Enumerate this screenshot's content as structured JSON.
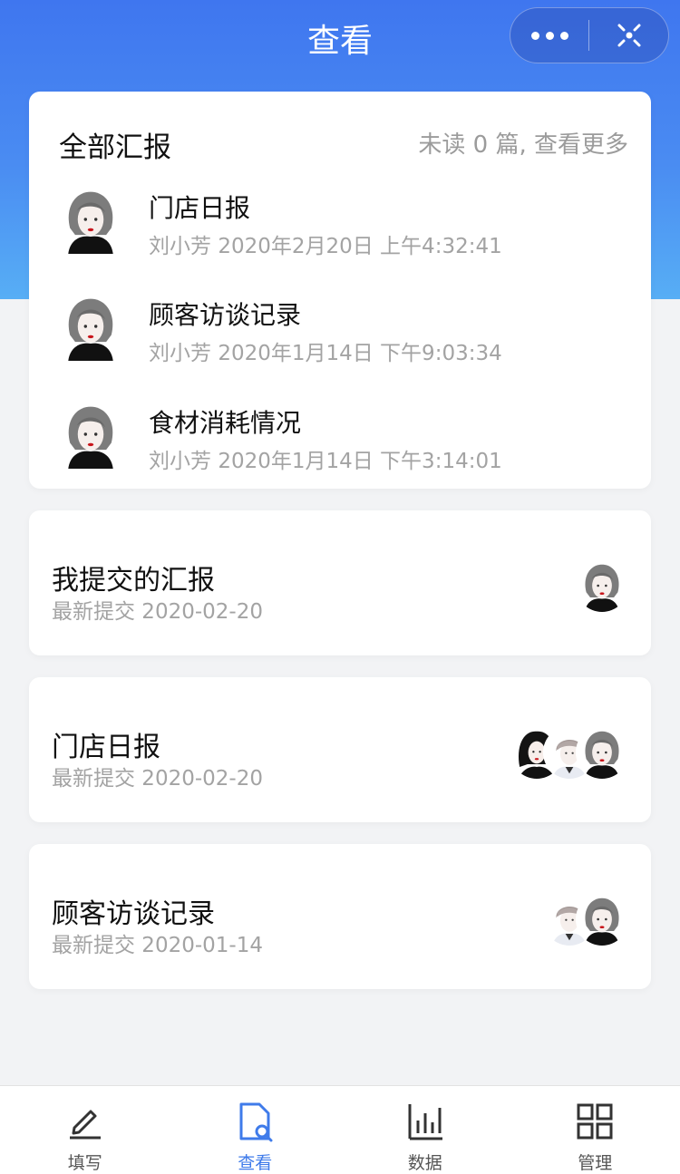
{
  "header": {
    "title": "查看"
  },
  "capsule": {
    "more_icon": "more-dots-icon",
    "close_icon": "close-target-icon"
  },
  "all_reports": {
    "title": "全部汇报",
    "unread_link": "未读 0 篇, 查看更多",
    "items": [
      {
        "title": "门店日报",
        "author": "刘小芳",
        "time": "2020年2月20日 上午4:32:41"
      },
      {
        "title": "顾客访谈记录",
        "author": "刘小芳",
        "time": "2020年1月14日 下午9:03:34"
      },
      {
        "title": "食材消耗情况",
        "author": "刘小芳",
        "time": "2020年1月14日 下午3:14:01"
      }
    ]
  },
  "groups": [
    {
      "title": "我提交的汇报",
      "subtitle": "最新提交 2020-02-20"
    },
    {
      "title": "门店日报",
      "subtitle": "最新提交 2020-02-20"
    },
    {
      "title": "顾客访谈记录",
      "subtitle": "最新提交 2020-01-14"
    }
  ],
  "tabbar": {
    "items": [
      {
        "label": "填写",
        "icon": "pencil-icon"
      },
      {
        "label": "查看",
        "icon": "document-search-icon",
        "active": true
      },
      {
        "label": "数据",
        "icon": "bar-chart-icon"
      },
      {
        "label": "管理",
        "icon": "grid-icon"
      }
    ]
  },
  "colors": {
    "accent": "#3f7bea",
    "header_top": "#3f76ef",
    "header_bottom": "#57aef5",
    "muted_text": "#a3a3a3"
  }
}
